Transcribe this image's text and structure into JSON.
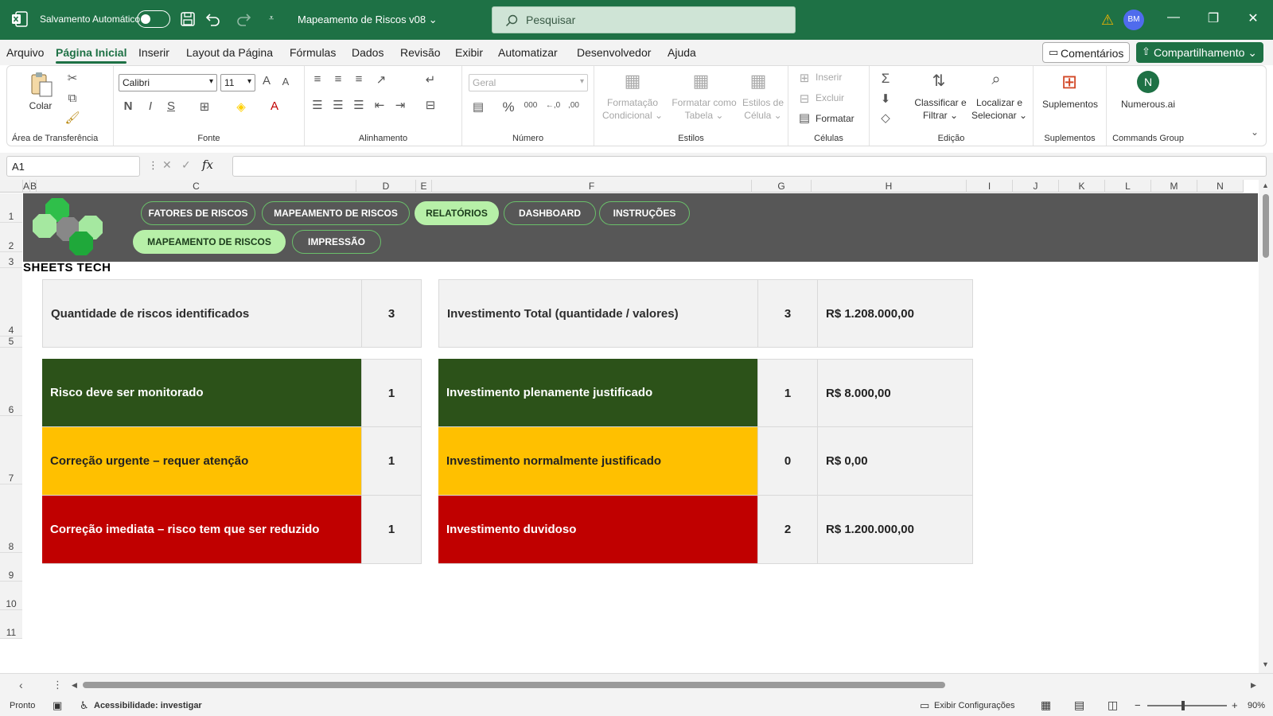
{
  "titlebar": {
    "autosave_label": "Salvamento Automático",
    "doc_name": "Mapeamento de Riscos v08 ⌄",
    "search_placeholder": "Pesquisar",
    "avatar": "BM"
  },
  "menu": {
    "tabs": [
      "Arquivo",
      "Página Inicial",
      "Inserir",
      "Layout da Página",
      "Fórmulas",
      "Dados",
      "Revisão",
      "Exibir",
      "Automatizar",
      "Desenvolvedor",
      "Ajuda"
    ],
    "comments": "Comentários",
    "share": "Compartilhamento ⌄"
  },
  "ribbon": {
    "paste": "Colar",
    "clipboard": "Área de Transferência",
    "font_name": "Calibri",
    "font_size": "11",
    "font_group": "Fonte",
    "align_group": "Alinhamento",
    "number_format": "Geral",
    "number_group": "Número",
    "cond_format": "Formatação Condicional ⌄",
    "format_table": "Formatar como Tabela ⌄",
    "cell_styles": "Estilos de Célula ⌄",
    "styles_group": "Estilos",
    "insert": "Inserir",
    "delete": "Excluir",
    "format": "Formatar",
    "cells_group": "Células",
    "sort": "Classificar e Filtrar ⌄",
    "find": "Localizar e Selecionar ⌄",
    "edit_group": "Edição",
    "addins": "Suplementos",
    "addins_group": "Suplementos",
    "numerous": "Numerous.ai",
    "commands_group": "Commands Group"
  },
  "formula_bar": {
    "name_box": "A1",
    "fx": "fx",
    "value": ""
  },
  "columns": [
    {
      "label": "A",
      "w": 9
    },
    {
      "label": "B",
      "w": 8
    },
    {
      "label": "C",
      "w": 402
    },
    {
      "label": "D",
      "w": 75
    },
    {
      "label": "E",
      "w": 20
    },
    {
      "label": "F",
      "w": 402
    },
    {
      "label": "G",
      "w": 75
    },
    {
      "label": "H",
      "w": 195
    },
    {
      "label": "I",
      "w": 58
    },
    {
      "label": "J",
      "w": 58
    },
    {
      "label": "K",
      "w": 58
    },
    {
      "label": "L",
      "w": 58
    },
    {
      "label": "M",
      "w": 58
    },
    {
      "label": "N",
      "w": 58
    }
  ],
  "rows": [
    "1",
    "2",
    "3",
    "4",
    "5",
    "6",
    "7",
    "8",
    "9",
    "10",
    "11"
  ],
  "nav": {
    "row1": [
      "FATORES DE RISCOS",
      "MAPEAMENTO DE RISCOS",
      "RELATÓRIOS",
      "DASHBOARD",
      "INSTRUÇÕES"
    ],
    "row2": [
      "MAPEAMENTO DE RISCOS",
      "IMPRESSÃO"
    ],
    "active_top": "RELATÓRIOS"
  },
  "brand": "SHEETS TECH",
  "summary": {
    "risks_label": "Quantidade de riscos identificados",
    "risks_count": "3",
    "invest_label": "Investimento Total (quantidade / valores)",
    "invest_count": "3",
    "invest_total": "R$ 1.208.000,00"
  },
  "risk_rows": [
    {
      "label": "Risco deve ser monitorado",
      "count": "1",
      "color": "#2c5219"
    },
    {
      "label": "Correção urgente – requer atenção",
      "count": "1",
      "color": "#ffc000"
    },
    {
      "label": "Correção imediata – risco tem que ser reduzido",
      "count": "1",
      "color": "#c00000"
    }
  ],
  "invest_rows": [
    {
      "label": "Investimento plenamente justificado",
      "count": "1",
      "value": "R$ 8.000,00"
    },
    {
      "label": "Investimento normalmente justificado",
      "count": "0",
      "value": "R$ 0,00"
    },
    {
      "label": "Investimento duvidoso",
      "count": "2",
      "value": "R$ 1.200.000,00"
    }
  ],
  "status": {
    "ready": "Pronto",
    "accessibility": "Acessibilidade: investigar",
    "display_settings": "Exibir Configurações",
    "zoom": "90%"
  }
}
